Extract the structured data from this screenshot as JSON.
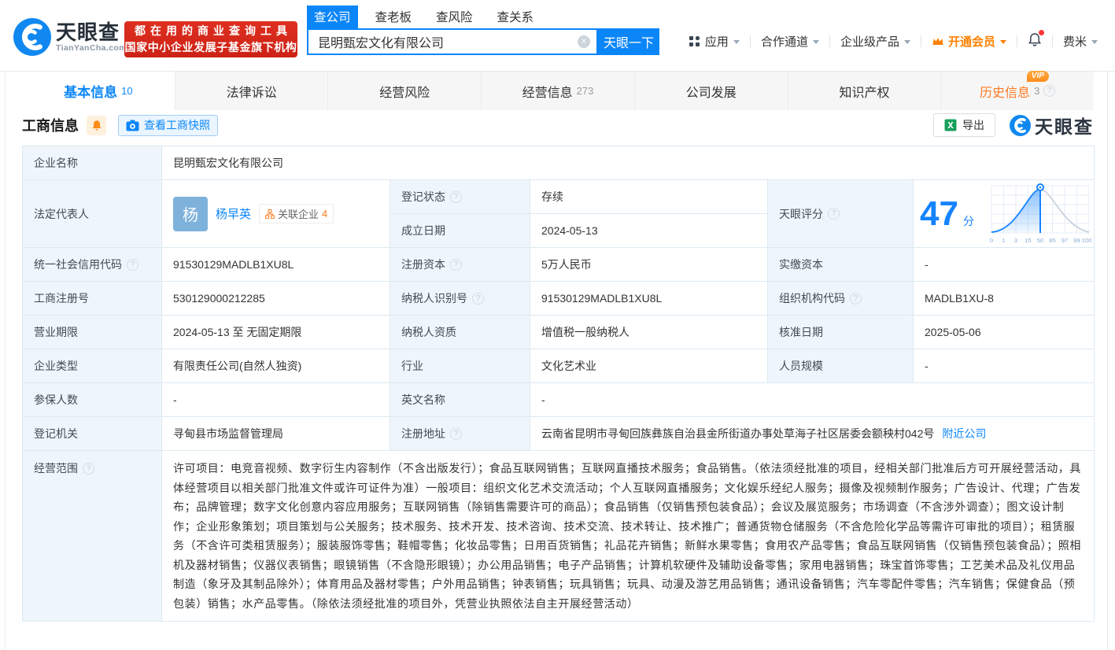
{
  "header": {
    "logo_title": "天眼查",
    "logo_subtitle": "TianYanCha.com",
    "slogan_line1": "都在用的商业查询工具",
    "slogan_line2": "国家中小企业发展子基金旗下机构",
    "search_tabs": [
      {
        "label": "查公司"
      },
      {
        "label": "查老板"
      },
      {
        "label": "查风险"
      },
      {
        "label": "查关系"
      }
    ],
    "search_query": "昆明甄宏文化有限公司",
    "search_button": "天眼一下",
    "menu": {
      "apps": "应用",
      "partner": "合作通道",
      "enterprise": "企业级产品",
      "vip": "开通会员",
      "user": "费米"
    }
  },
  "nav_tabs": [
    {
      "label": "基本信息",
      "count": "10"
    },
    {
      "label": "法律诉讼",
      "count": ""
    },
    {
      "label": "经营风险",
      "count": ""
    },
    {
      "label": "经营信息",
      "count": "273"
    },
    {
      "label": "公司发展",
      "count": ""
    },
    {
      "label": "知识产权",
      "count": ""
    },
    {
      "label": "历史信息",
      "count": "3",
      "vip_badge": "VIP"
    }
  ],
  "section": {
    "title": "工商信息",
    "snapshot_button": "查看工商快照",
    "export_button": "导出",
    "watermark_logo": "天眼查"
  },
  "biz": {
    "company_name_label": "企业名称",
    "company_name": "昆明甄宏文化有限公司",
    "legal_rep_label": "法定代表人",
    "legal_rep_avatar": "杨",
    "legal_rep_name": "杨早英",
    "related_label": "关联企业",
    "related_count": "4",
    "reg_status_label": "登记状态",
    "reg_status": "存续",
    "est_date_label": "成立日期",
    "est_date": "2024-05-13",
    "score_label": "天眼评分",
    "score": "47",
    "score_unit": "分",
    "credit_code_label": "统一社会信用代码",
    "credit_code": "91530129MADLB1XU8L",
    "reg_capital_label": "注册资本",
    "reg_capital": "5万人民币",
    "paid_capital_label": "实缴资本",
    "paid_capital": "-",
    "reg_number_label": "工商注册号",
    "reg_number": "530129000212285",
    "taxpayer_id_label": "纳税人识别号",
    "taxpayer_id": "91530129MADLB1XU8L",
    "org_code_label": "组织机构代码",
    "org_code": "MADLB1XU-8",
    "biz_term_label": "营业期限",
    "biz_term": "2024-05-13 至 无固定期限",
    "taxpayer_quality_label": "纳税人资质",
    "taxpayer_quality": "增值税一般纳税人",
    "approval_date_label": "核准日期",
    "approval_date": "2025-05-06",
    "company_type_label": "企业类型",
    "company_type": "有限责任公司(自然人独资)",
    "industry_label": "行业",
    "industry": "文化艺术业",
    "staff_size_label": "人员规模",
    "staff_size": "-",
    "insured_label": "参保人数",
    "insured": "-",
    "english_name_label": "英文名称",
    "english_name": "-",
    "reg_authority_label": "登记机关",
    "reg_authority": "寻甸县市场监督管理局",
    "address_label": "注册地址",
    "address": "云南省昆明市寻甸回族彝族自治县金所街道办事处草海子社区居委会额秧村042号",
    "nearby_link": "附近公司",
    "scope_label": "经营范围",
    "scope": "许可项目：电竞音视频、数字衍生内容制作（不含出版发行）；食品互联网销售；互联网直播技术服务；食品销售。（依法须经批准的项目，经相关部门批准后方可开展经营活动，具体经营项目以相关部门批准文件或许可证件为准）一般项目：组织文化艺术交流活动；个人互联网直播服务；文化娱乐经纪人服务；摄像及视频制作服务；广告设计、代理；广告发布；品牌管理；数字文化创意内容应用服务；互联网销售（除销售需要许可的商品）；食品销售（仅销售预包装食品）；会议及展览服务；市场调查（不含涉外调查）；图文设计制作；企业形象策划；项目策划与公关服务；技术服务、技术开发、技术咨询、技术交流、技术转让、技术推广；普通货物仓储服务（不含危险化学品等需许可审批的项目）；租赁服务（不含许可类租赁服务）；服装服饰零售；鞋帽零售；化妆品零售；日用百货销售；礼品花卉销售；新鲜水果零售；食用农产品零售；食品互联网销售（仅销售预包装食品）；照相机及器材销售；仪器仪表销售；眼镜销售（不含隐形眼镜）；办公用品销售；电子产品销售；计算机软硬件及辅助设备零售；家用电器销售；珠宝首饰零售；工艺美术品及礼仪用品制造（象牙及其制品除外）；体育用品及器材零售；户外用品销售；钟表销售；玩具销售；玩具、动漫及游艺用品销售；通讯设备销售；汽车零配件零售；汽车销售；保健食品（预包装）销售；水产品零售。（除依法须经批准的项目外，凭营业执照依法自主开展经营活动）"
  },
  "score_chart": {
    "type": "area",
    "x_labels": [
      "0",
      "1",
      "3",
      "15",
      "50",
      "85",
      "97",
      "99",
      "100"
    ],
    "score": 47,
    "marker_at_label": "50",
    "accent_color": "#1583ff"
  }
}
